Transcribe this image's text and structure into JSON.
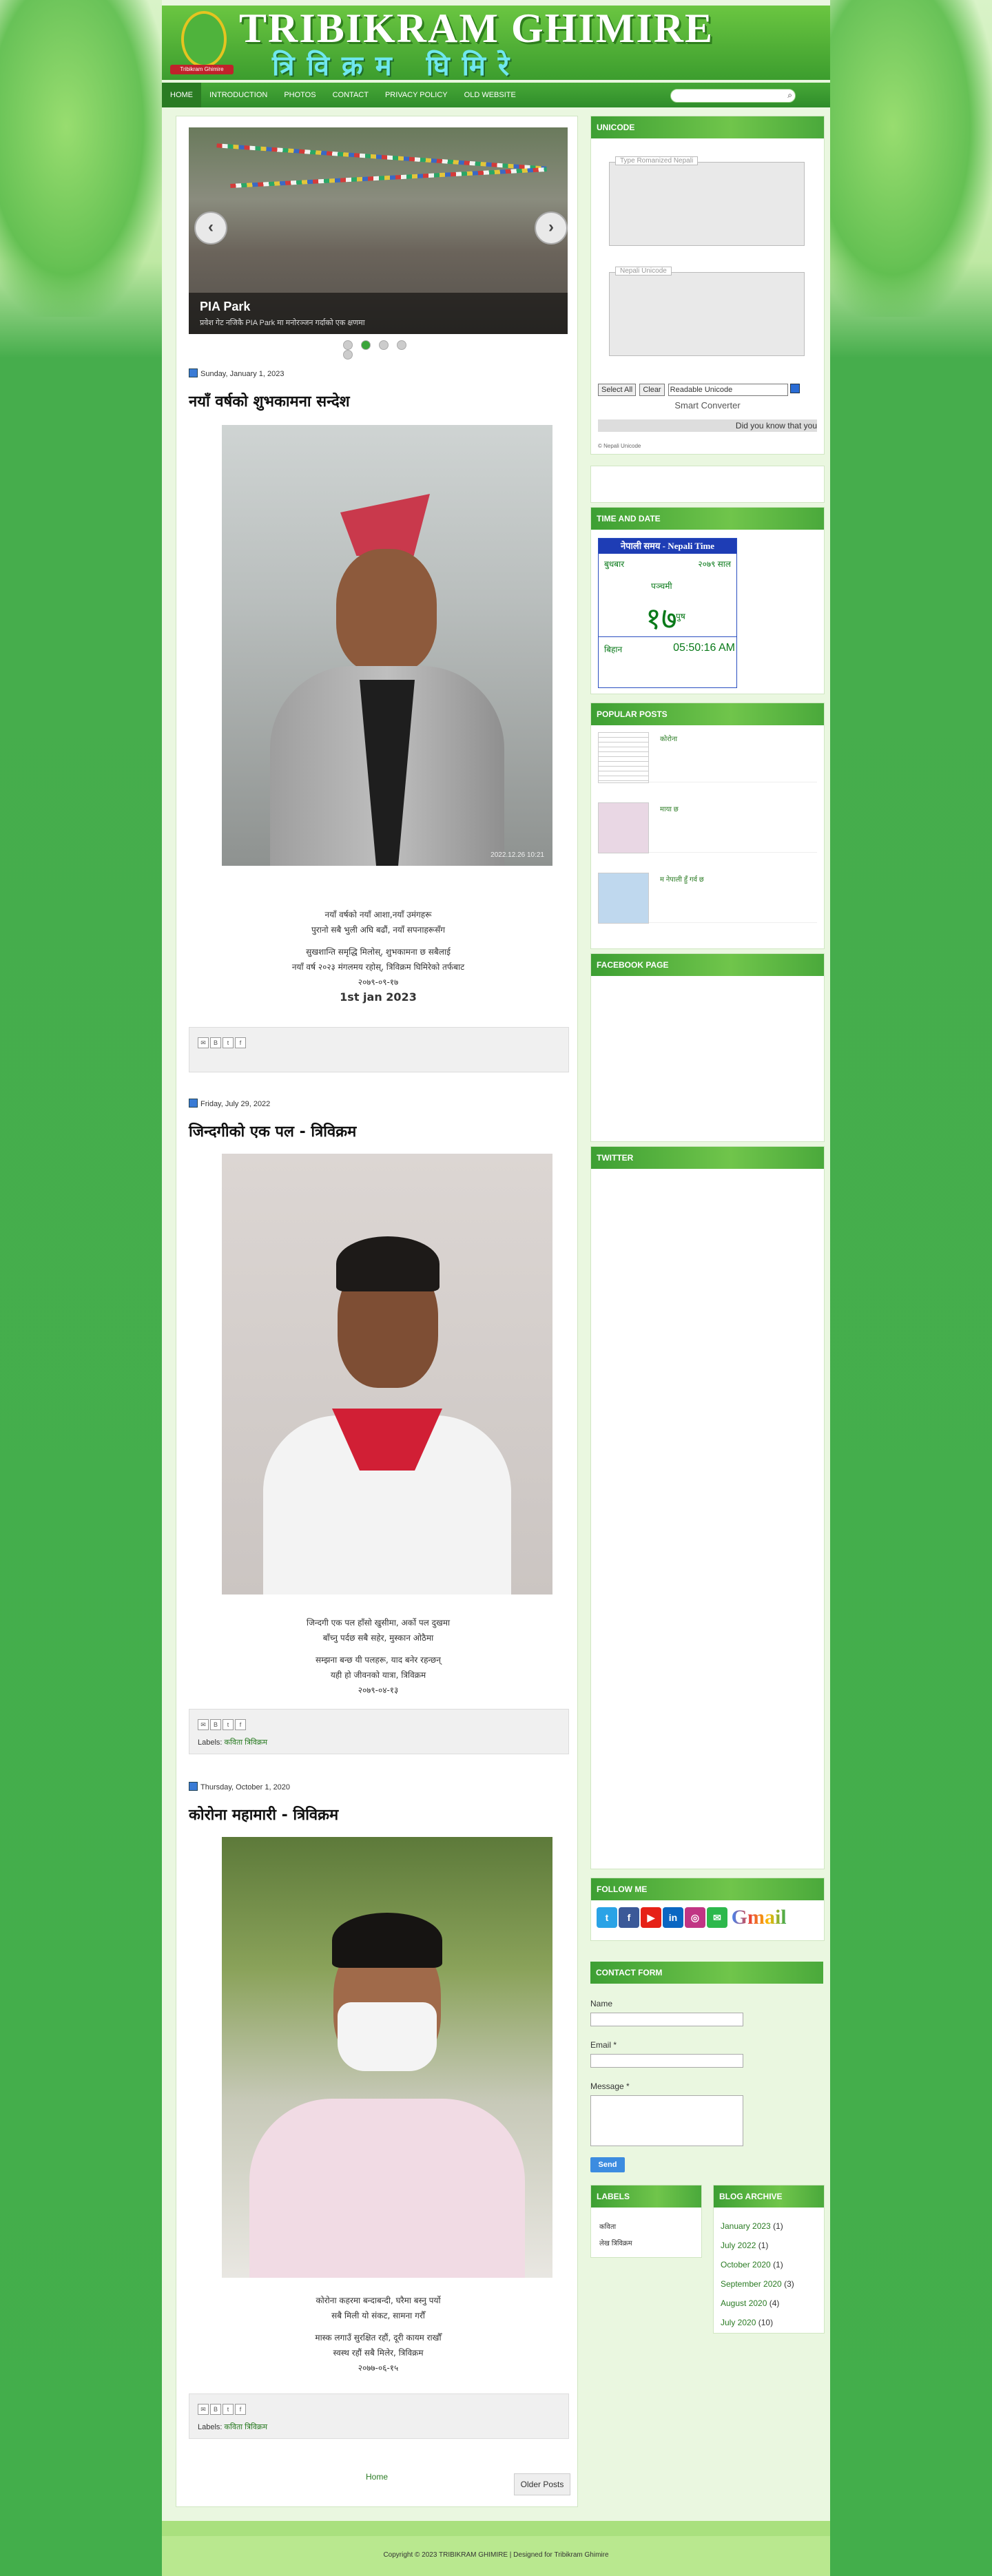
{
  "header": {
    "title": "TRIBIKRAM GHIMIRE",
    "subtitle": "त्रिविक्रम घिमिरे",
    "logo_tag": "Tribikram Ghimire"
  },
  "nav": {
    "items": [
      "HOME",
      "INTRODUCTION",
      "PHOTOS",
      "CONTACT",
      "PRIVACY POLICY",
      "OLD WEBSITE"
    ]
  },
  "slider": {
    "title": "PIA Park",
    "description": "प्रवेश गेट नजिकै PIA Park मा मनोरञ्जन गर्दाको एक क्षणमा",
    "prev": "‹",
    "next": "›"
  },
  "posts": [
    {
      "date": "Sunday, January 1, 2023",
      "title": "नयाँ वर्षको शुभकामना सन्देश",
      "photo_stamp": "2022.12.26 10:21",
      "poem": [
        "नयाँ वर्षको नयाँ आशा,नयाँ उमंगहरू",
        "पुरानो सबै भुली अघि बढौं, नयाँ सपनाहरूसँग",
        "",
        "सुखशान्ति समृद्धि मिलोस्, शुभकामना छ सबैलाई",
        "नयाँ वर्ष २०२३ मंगलमय रहोस्, त्रिविक्रम घिमिरेको तर्फबाट",
        "२०७९-०९-१७"
      ],
      "date_line": "1st jan 2023",
      "labels": ""
    },
    {
      "date": "Friday, July 29, 2022",
      "title": "जिन्दगीको एक पल - त्रिविक्रम",
      "poem": [
        "जिन्दगी एक पल हाँसो खुसीमा, अर्को पल दुखमा",
        "बाँच्नु पर्दछ सबै सहेर, मुस्कान ओठैमा",
        "",
        "सम्झना बन्छ यी पलहरू, याद बनेर रहन्छन्",
        "यही हो जीवनको यात्रा, त्रिविक्रम",
        "२०७९-०४-१३"
      ],
      "labels": "कविता त्रिविक्रम"
    },
    {
      "date": "Thursday, October 1, 2020",
      "title": "कोरोना महामारी - त्रिविक्रम",
      "poem": [
        "कोरोना कहरमा बन्दाबन्दी, घरैमा बस्नु पर्यो",
        "सबै मिली यो संकट, सामना गरौँ",
        "",
        "मास्क लगाउँ सुरक्षित रहौं, दूरी कायम राखौँ",
        "स्वस्थ रहौं सबै मिलेर, त्रिविक्रम",
        "२०७७-०६-१५"
      ],
      "labels": "कविता त्रिविक्रम"
    }
  ],
  "pager": {
    "home": "Home",
    "older": "Older Posts"
  },
  "unicode_widget": {
    "title": "UNICODE",
    "romanized_legend": "Type Romanized Nepali",
    "unicode_legend": "Nepali Unicode",
    "select_all": "Select All",
    "clear": "Clear",
    "mode": "Readable Unicode",
    "smart_converter": "Smart Converter",
    "did_you_know": "Did you know that you",
    "footer_link": "© Nepali Unicode"
  },
  "time_widget": {
    "title": "TIME AND DATE",
    "header": "नेपाली समय - Nepali Time",
    "weekday": "बुधबार",
    "year": "२०७९ साल",
    "tithi": "पञ्चमी",
    "day": "१७",
    "month": "पुष",
    "period": "बिहान",
    "time": "05:50:16 AM"
  },
  "popular": {
    "title": "POPULAR POSTS",
    "items": [
      "कोरोना",
      "माया छ",
      "म नेपाली हुँ गर्व छ"
    ]
  },
  "facebook": {
    "title": "FACEBOOK PAGE"
  },
  "twitter": {
    "title": "TWITTER"
  },
  "follow": {
    "title": "FOLLOW ME",
    "gmail": "Gmail"
  },
  "contact": {
    "title": "CONTACT FORM",
    "name_label": "Name",
    "email_label": "Email *",
    "message_label": "Message *",
    "send": "Send"
  },
  "labels_widget": {
    "title": "LABELS",
    "items": [
      "कविता",
      "लेख त्रिविक्रम"
    ]
  },
  "archive": {
    "title": "BLOG ARCHIVE",
    "items": [
      {
        "label": "January 2023",
        "count": "(1)"
      },
      {
        "label": "July 2022",
        "count": "(1)"
      },
      {
        "label": "October 2020",
        "count": "(1)"
      },
      {
        "label": "September 2020",
        "count": "(3)"
      },
      {
        "label": "August 2020",
        "count": "(4)"
      },
      {
        "label": "July 2020",
        "count": "(10)"
      }
    ]
  },
  "footer": {
    "copyright": "Copyright © 2023 TRIBIKRAM GHIMIRE | Designed for Tribikram Ghimire"
  },
  "colors": {
    "accent": "#3d9f33",
    "link": "#2a7b23",
    "background": "#43ae4b"
  }
}
